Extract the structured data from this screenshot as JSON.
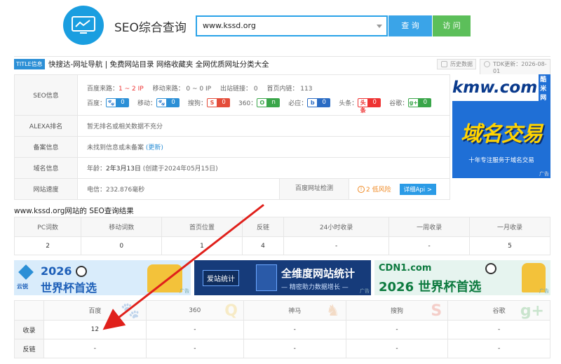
{
  "header": {
    "title": "SEO综合查询",
    "search_value": "www.kssd.org",
    "query_label": "查 询",
    "visit_label": "访 问"
  },
  "title_row": {
    "badge": "TITLE信息",
    "text": "快搜达-网址导航 | 免费网站目录 网络收藏夹 全网优质网址分类大全",
    "history": "历史数据",
    "tdk": "TDK更新：2026-08-01"
  },
  "seo": {
    "label": "SEO信息",
    "baidu_source_label": "百度来路：",
    "baidu_source_value": "1 ~ 2 IP",
    "mobile_source": "移动来路： 0 ~ 0 IP",
    "outbound": "出站链接： 0",
    "home_inlinks": "首页内链： 113",
    "weights": [
      {
        "name": "百度：",
        "icon": "paw-icon",
        "icon_text": "🐾",
        "value": "0",
        "color": "#2b8fd6"
      },
      {
        "name": "移动：",
        "icon": "paw-icon",
        "icon_text": "🐾",
        "value": "0",
        "color": "#2b8fd6"
      },
      {
        "name": "搜狗：",
        "icon": "sogou-icon",
        "icon_text": "S",
        "value": "0",
        "color": "#e44d3a"
      },
      {
        "name": "360：",
        "icon": "360-icon",
        "icon_text": "O",
        "value": "n",
        "color": "#3aa64a"
      },
      {
        "name": "必应：",
        "icon": "bing-icon",
        "icon_text": "b",
        "value": "0",
        "color": "#2b6cc4"
      },
      {
        "name": "头条：",
        "icon": "toutiao-icon",
        "icon_text": "头条",
        "value": "0",
        "color": "#e33"
      },
      {
        "name": "谷歌：",
        "icon": "google-plus-icon",
        "icon_text": "g+",
        "value": "0",
        "color": "#3aa64a"
      }
    ]
  },
  "alexa": {
    "label": "ALEXA排名",
    "value": "暂无排名或相关数据不充分"
  },
  "beian": {
    "label": "备案信息",
    "value": "未找到信息或未备案",
    "update": "(更新)"
  },
  "domain": {
    "label": "域名信息",
    "age_label": "年龄：",
    "age": "2年3月13日",
    "created": "(创建于2024年05月15日)"
  },
  "speed": {
    "label": "网站速度",
    "value": "电信：232.876毫秒",
    "detect_label": "百度网址检测",
    "risk": "2 低风险",
    "detail_btn": "详细Api >"
  },
  "ad_right": {
    "brand": "kmw.com",
    "brand_cn": "酷米网",
    "headline": "域名交易",
    "sub": "十年专注服务于域名交易",
    "tag": "广告"
  },
  "result": {
    "title": "www.kssd.org网站的 SEO查询结果",
    "headers": [
      "PC词数",
      "移动词数",
      "首页位置",
      "反链",
      "24小时收录",
      "一周收录",
      "一月收录"
    ],
    "values": [
      "2",
      "0",
      "1",
      "4",
      "-",
      "-",
      "5"
    ]
  },
  "banners": {
    "b1": {
      "brand": "云锐",
      "line1": "2026",
      "line2": "世界杯首选",
      "tag": "广告"
    },
    "b2": {
      "brand": "爱站统计",
      "line1": "全维度网站统计",
      "line2": "— 精密助力数据增长 —",
      "tag": "广告"
    },
    "b3": {
      "brand": "CDN1.com",
      "line1": "2026 世界杯首选",
      "tag": "广告"
    }
  },
  "engines": {
    "headers": [
      "百度",
      "360",
      "神马",
      "搜狗",
      "谷歌"
    ],
    "rows": [
      {
        "label": "收录",
        "values": [
          "12",
          "-",
          "-",
          "-",
          "-"
        ]
      },
      {
        "label": "反链",
        "values": [
          "-",
          "-",
          "-",
          "-",
          "-"
        ]
      }
    ]
  }
}
